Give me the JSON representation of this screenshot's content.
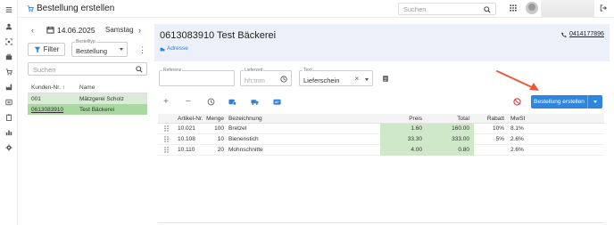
{
  "topbar": {
    "title": "Bestellung erstellen",
    "search_placeholder": "Suchen"
  },
  "left": {
    "date": "14.06.2025",
    "weekday": "Samstag",
    "filter_label": "Filter",
    "bestelltyp_label": "Bestelltyp",
    "bestelltyp_value": "Bestellung",
    "search_placeholder": "Suchen",
    "columns": {
      "nr": "Kunden-Nr.",
      "name": "Name"
    },
    "rows": [
      {
        "nr": "001",
        "name": "Mätzgerei Scholz"
      },
      {
        "nr": "0613083910",
        "name": "Test Bäckerei"
      }
    ]
  },
  "customer": {
    "title": "0613083910 Test Bäckerei",
    "address_link": "Adresse",
    "phone": "0414177896"
  },
  "form": {
    "referenz_label": "Referenz",
    "referenz_value": "",
    "lieferzeit_label": "Lieferzeit",
    "lieferzeit_placeholder": "hh:mm",
    "text_label": "Text",
    "text_value": "Lieferschein"
  },
  "toolbar": {
    "order_button": "Bestellung erstellen"
  },
  "accent_color": "#2f86de",
  "items": {
    "columns": {
      "art": "Artikel-Nr.",
      "menge": "Menge",
      "bez": "Bezeichnung",
      "preis": "Preis",
      "total": "Total",
      "rabatt": "Rabatt",
      "mwst": "MwSt"
    },
    "rows": [
      {
        "art": "10.021",
        "menge": "100",
        "bez": "Bretzel",
        "preis": "1.60",
        "total": "160.00",
        "rabatt": "10%",
        "mwst": "8.1%"
      },
      {
        "art": "10.108",
        "menge": "10",
        "bez": "Bienenstich",
        "preis": "33.30",
        "total": "333.00",
        "rabatt": "5%",
        "mwst": "2.6%"
      },
      {
        "art": "10.110",
        "menge": "20",
        "bez": "Mohnschnitte",
        "preis": "4.00",
        "total": "0.80",
        "rabatt": "",
        "mwst": "2.6%"
      }
    ]
  }
}
